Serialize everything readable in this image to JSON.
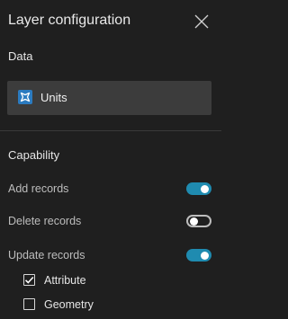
{
  "header": {
    "title": "Layer configuration",
    "close_icon": "close-icon"
  },
  "data_section": {
    "label": "Data",
    "layer": {
      "name": "Units",
      "icon": "layer-icon",
      "icon_color": "#2b7bc0"
    }
  },
  "capability_section": {
    "label": "Capability",
    "toggles": [
      {
        "label": "Add records",
        "on": true
      },
      {
        "label": "Delete records",
        "on": false
      },
      {
        "label": "Update records",
        "on": true
      }
    ],
    "update_options": [
      {
        "label": "Attribute",
        "checked": true
      },
      {
        "label": "Geometry",
        "checked": false
      }
    ]
  },
  "colors": {
    "background": "#1f1f1f",
    "toggle_on": "#1f8bb0",
    "layer_box": "#3c3c3c"
  }
}
